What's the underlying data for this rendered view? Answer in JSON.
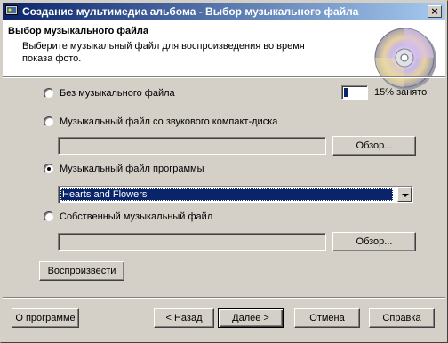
{
  "window": {
    "title": "Создание мультимедиа альбома - Выбор музыкального файла"
  },
  "header": {
    "title": "Выбор музыкального файла",
    "description": "Выберите музыкальный файл для воспроизведения во время показа фото."
  },
  "usage": {
    "fraction": 0.15,
    "label": "15% занято"
  },
  "options": {
    "no_music": "Без музыкального файла",
    "cd_audio": "Музыкальный файл со звукового компакт-диска",
    "program_music": "Музыкальный файл программы",
    "own_music": "Собственный музыкальный файл"
  },
  "selected_option": "program_music",
  "cd_audio_path": "",
  "own_music_path": "",
  "browse_label": "Обзор...",
  "program_music_select": {
    "value": "Hearts and Flowers"
  },
  "play_label": "Воспроизвести",
  "footer": {
    "about": "О программе",
    "back_arrow": "<",
    "back": "Назад",
    "next": "Далее",
    "next_arrow": ">",
    "cancel": "Отмена",
    "help": "Справка"
  },
  "colors": {
    "title_gradient_start": "#0a246a",
    "title_gradient_end": "#a6caf0",
    "selection": "#0a246a"
  }
}
